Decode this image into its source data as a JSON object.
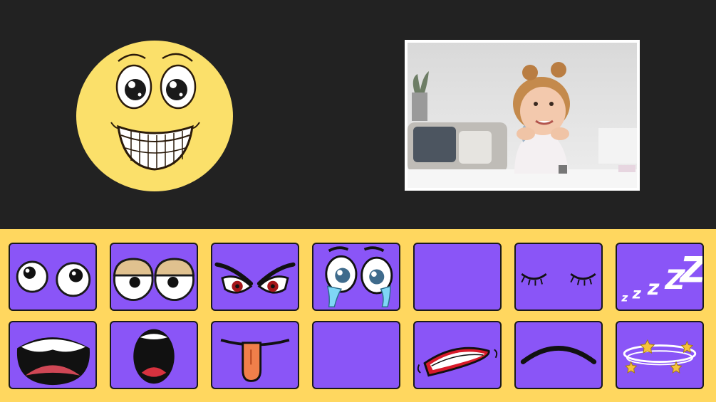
{
  "colors": {
    "background": "#222222",
    "palette_bg": "#ffd75f",
    "tile_bg": "#8a55f7",
    "tile_border": "#1a1a1a",
    "emoji_face": "#fbe06a"
  },
  "canvas": {
    "emoji": {
      "name": "grinning-face",
      "description_icon": "smiley-face-icon"
    },
    "photo": {
      "name": "child-photo"
    }
  },
  "palette": {
    "rows": [
      [
        {
          "id": "round-eyes",
          "icon": "round-eyes-icon"
        },
        {
          "id": "sleepy-lidded-eyes",
          "icon": "sleepy-eyes-icon"
        },
        {
          "id": "angry-eyes",
          "icon": "angry-eyes-icon"
        },
        {
          "id": "crying-eyes",
          "icon": "crying-eyes-icon"
        },
        {
          "id": "empty",
          "icon": "empty-slot"
        },
        {
          "id": "closed-eyes",
          "icon": "closed-eyes-icon"
        },
        {
          "id": "sleep-zzz",
          "icon": "zzz-icon"
        }
      ],
      [
        {
          "id": "screaming-mouth",
          "icon": "screaming-mouth-icon"
        },
        {
          "id": "shocked-mouth",
          "icon": "shocked-mouth-icon"
        },
        {
          "id": "tongue-out-mouth",
          "icon": "tongue-mouth-icon"
        },
        {
          "id": "empty",
          "icon": "empty-slot"
        },
        {
          "id": "gritted-teeth-mouth",
          "icon": "gritted-teeth-icon"
        },
        {
          "id": "frown-mouth",
          "icon": "frown-icon"
        },
        {
          "id": "dizzy-stars",
          "icon": "dizzy-stars-icon"
        }
      ]
    ]
  }
}
